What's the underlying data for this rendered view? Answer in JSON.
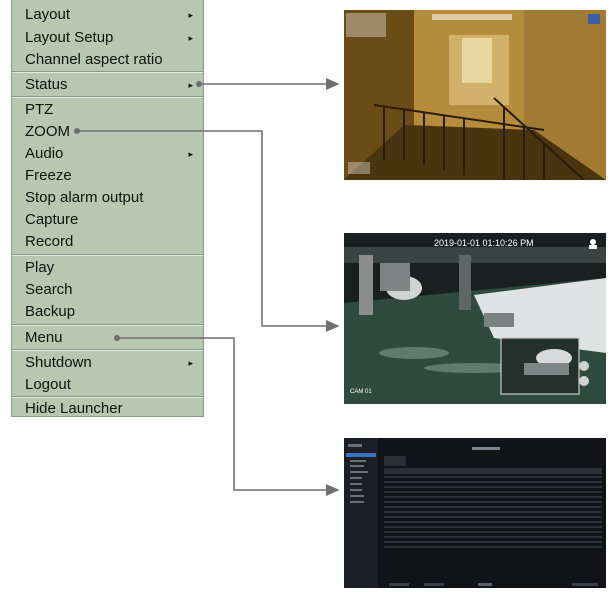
{
  "menu": {
    "items": [
      {
        "label": "Layout",
        "submenu": true
      },
      {
        "label": "Layout Setup",
        "submenu": true
      },
      {
        "label": "Channel aspect ratio",
        "submenu": false
      },
      {
        "label": "Status",
        "submenu": true
      },
      {
        "label": "PTZ",
        "submenu": false
      },
      {
        "label": "ZOOM",
        "submenu": false
      },
      {
        "label": "Audio",
        "submenu": true
      },
      {
        "label": "Freeze",
        "submenu": false
      },
      {
        "label": "Stop alarm output",
        "submenu": false
      },
      {
        "label": "Capture",
        "submenu": false
      },
      {
        "label": "Record",
        "submenu": false
      },
      {
        "label": "Play",
        "submenu": false
      },
      {
        "label": "Search",
        "submenu": false
      },
      {
        "label": "Backup",
        "submenu": false
      },
      {
        "label": "Menu",
        "submenu": false
      },
      {
        "label": "Shutdown",
        "submenu": true
      },
      {
        "label": "Logout",
        "submenu": false
      },
      {
        "label": "Hide Launcher",
        "submenu": false
      }
    ],
    "submenu_glyph": "▸"
  },
  "previews": {
    "zoom_view": {
      "timestamp": "2019-01-01 01:10:26 PM",
      "channel": "CAM 01"
    }
  },
  "colors": {
    "menu_bg": "#b7c7b2",
    "callout_line": "#6f6f6f"
  }
}
